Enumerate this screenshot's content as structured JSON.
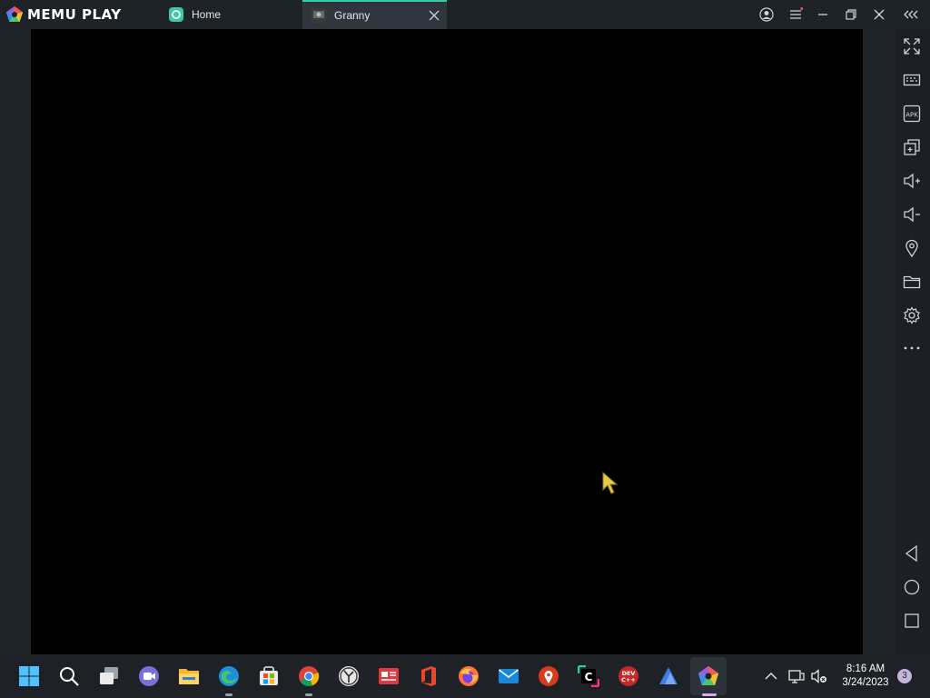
{
  "app": {
    "logo_text": "MEMU PLAY"
  },
  "tabs": [
    {
      "label": "Home",
      "icon": "memu-home-icon",
      "active": false
    },
    {
      "label": "Granny",
      "icon": "granny-app-icon",
      "active": true
    }
  ],
  "window_controls": [
    "account-icon",
    "menu-icon",
    "minimize-icon",
    "restore-icon",
    "close-icon",
    "collapse-toolbar-icon"
  ],
  "toolbar": [
    {
      "name": "fullscreen-icon"
    },
    {
      "name": "keyboard-mapping-icon"
    },
    {
      "name": "apk-install-icon"
    },
    {
      "name": "multi-instance-icon"
    },
    {
      "name": "volume-up-icon"
    },
    {
      "name": "volume-down-icon"
    },
    {
      "name": "location-icon"
    },
    {
      "name": "shared-folder-icon"
    },
    {
      "name": "settings-icon"
    },
    {
      "name": "more-icon"
    },
    {
      "name": "back-icon"
    },
    {
      "name": "home-nav-icon"
    },
    {
      "name": "recent-apps-icon"
    }
  ],
  "taskbar": {
    "apps": [
      "windows-start-icon",
      "search-icon",
      "task-view-icon",
      "teams-chat-icon",
      "file-explorer-icon",
      "edge-icon",
      "microsoft-store-icon",
      "chrome-icon",
      "clock-app-icon",
      "news-app-icon",
      "office-icon",
      "firefox-icon",
      "mail-icon",
      "maps-pin-icon",
      "clion-icon",
      "dev-cpp-icon",
      "bird-app-icon",
      "memu-taskbar-icon"
    ],
    "time": "8:16 AM",
    "date": "3/24/2023",
    "notification_count": "3"
  },
  "colors": {
    "accent": "#3ec7a6",
    "screen": "#000000",
    "chrome": "#1e2328"
  }
}
